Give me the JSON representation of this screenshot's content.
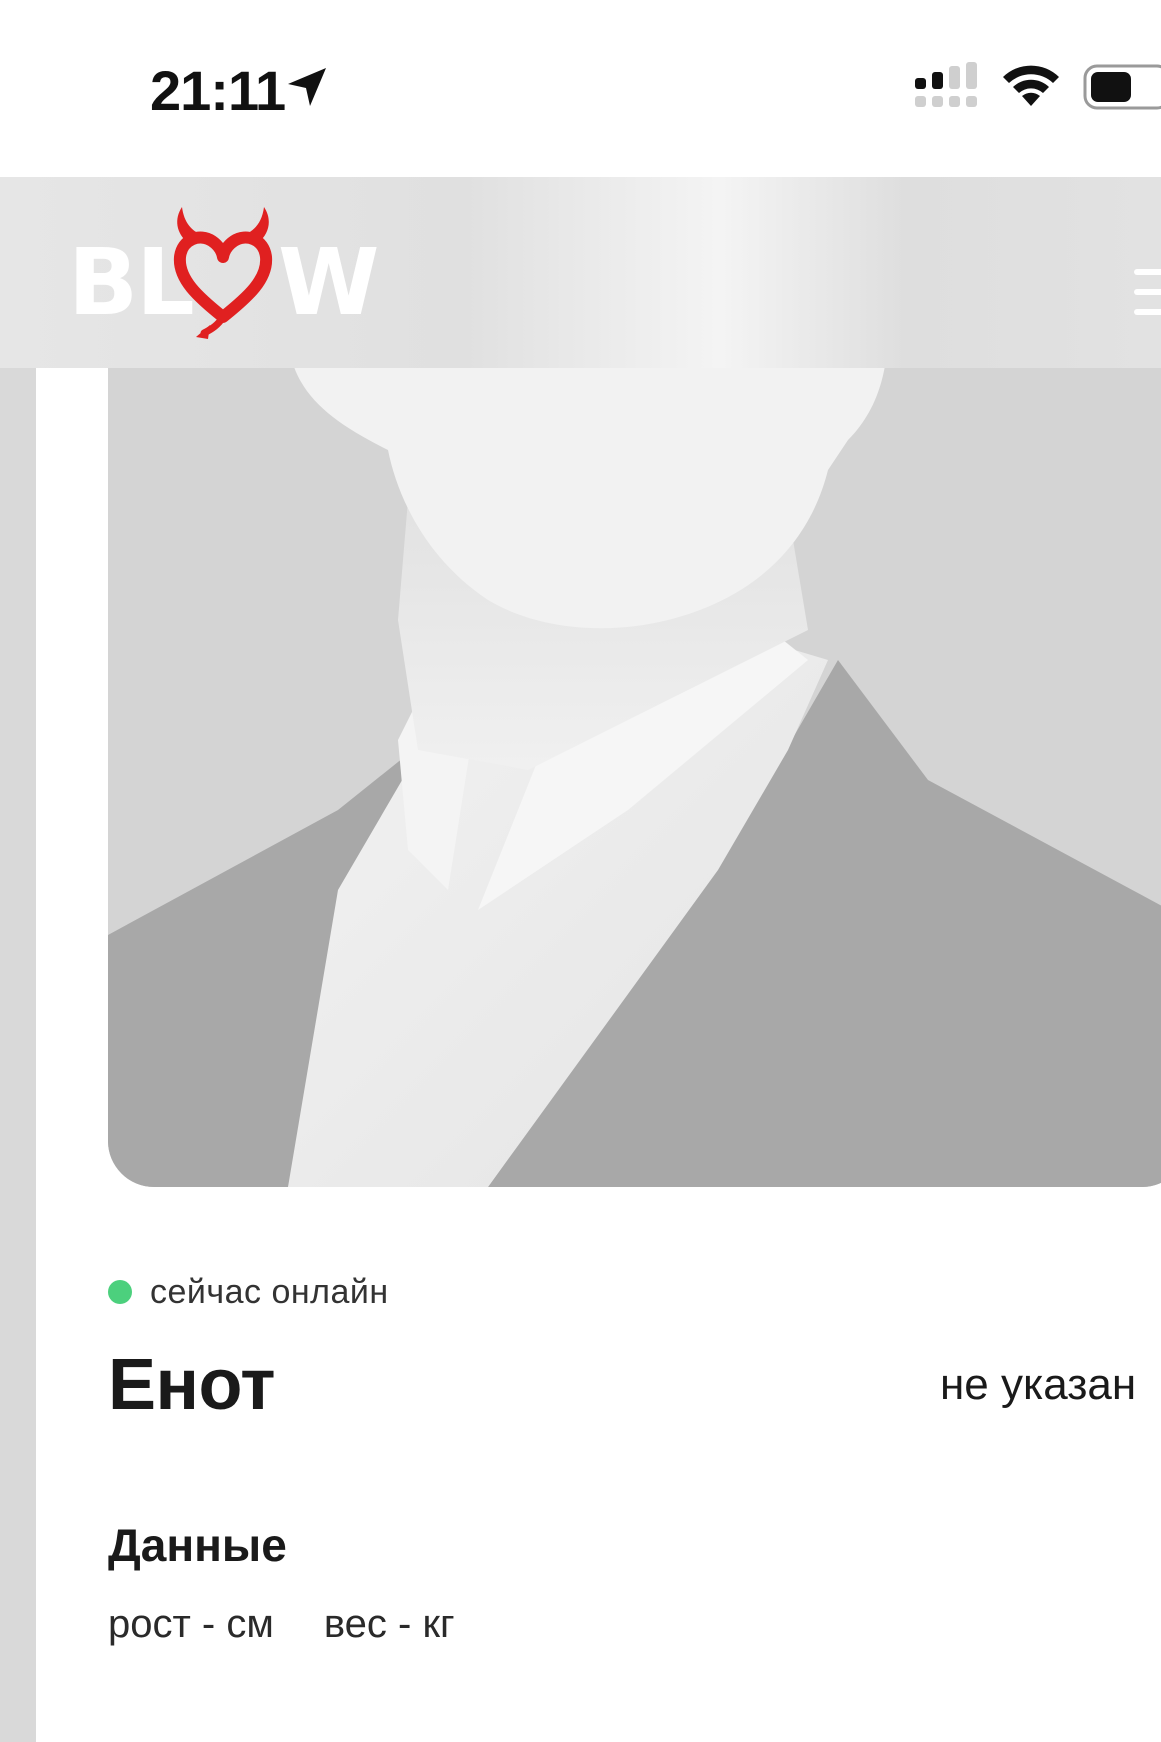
{
  "status_bar": {
    "time": "21:11",
    "icons": [
      "location-arrow-icon",
      "cellular-signal-icon",
      "wifi-icon",
      "battery-icon"
    ]
  },
  "header": {
    "logo_left": "BL",
    "logo_right": "W",
    "logo_icon": "devil-heart-icon",
    "menu_icon": "hamburger-menu-icon",
    "brand_color": "#e02020"
  },
  "profile": {
    "avatar_icon": "default-avatar-silhouette",
    "online_status": "сейчас онлайн",
    "online_color": "#4cd07d",
    "name": "Енот",
    "location": "не указан",
    "data_section": {
      "title": "Данные",
      "height": "рост - см",
      "weight": "вес - кг"
    }
  }
}
